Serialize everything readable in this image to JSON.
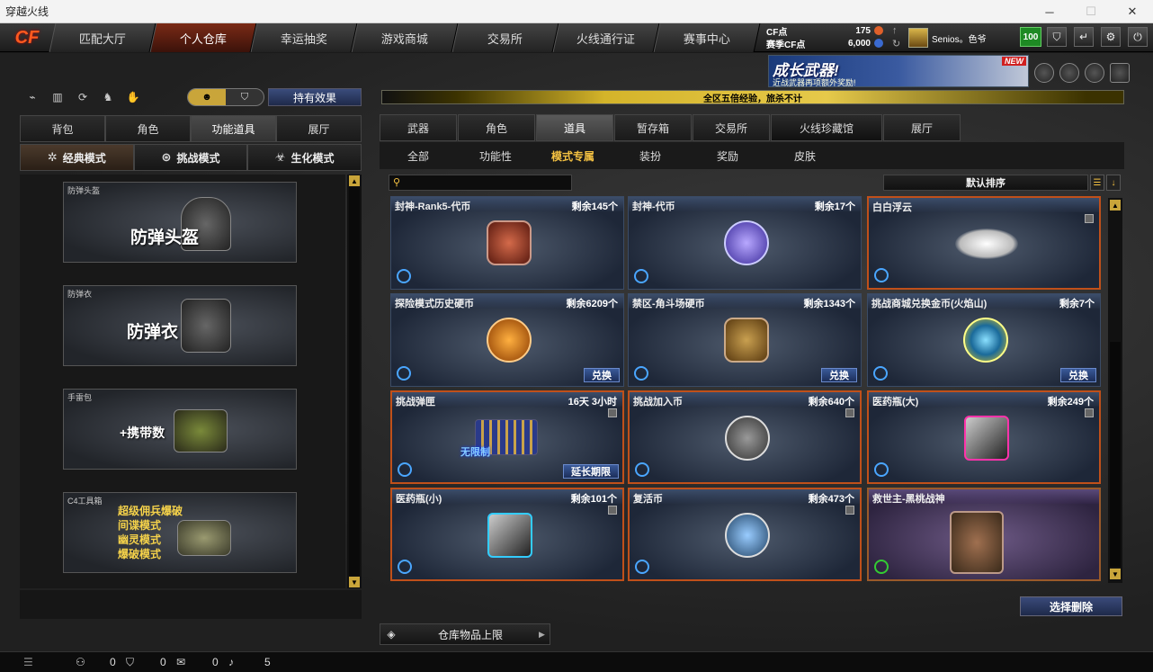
{
  "window": {
    "title": "穿越火线"
  },
  "nav": {
    "logo": "CF",
    "tabs": [
      "匹配大厅",
      "个人仓库",
      "幸运抽奖",
      "游戏商城",
      "交易所",
      "火线通行证",
      "赛事中心"
    ],
    "active_tab": "个人仓库"
  },
  "points": {
    "cf_label": "CF点",
    "cf_value": "175",
    "bonus_label": "赛季CF点",
    "bonus_value": "6,000"
  },
  "user": {
    "name": "Senios。色爷",
    "level": "100"
  },
  "left": {
    "toggle_icons": [
      "skull-icon",
      "shield-icon"
    ],
    "effect_button": "持有效果",
    "tabs": [
      "背包",
      "角色",
      "功能道具",
      "展厅"
    ],
    "active_tab": "功能道具",
    "modes": [
      "经典模式",
      "挑战模式",
      "生化模式"
    ],
    "active_mode": "经典模式",
    "cards": [
      {
        "label": "防弹头盔",
        "title": "防弹头盔"
      },
      {
        "label": "防弹衣",
        "title": "防弹衣"
      },
      {
        "label": "手雷包",
        "title": "+携带数"
      },
      {
        "label": "C4工具箱",
        "lines": [
          "超级佣兵爆破",
          "间谍模式",
          "幽灵模式",
          "爆破模式"
        ]
      }
    ]
  },
  "banner": {
    "title": "成长武器!",
    "subtitle": "近战武器再项额外奖励!",
    "badge": "NEW"
  },
  "marquee": "全区五倍经验，旅杀不计",
  "right": {
    "tabs": [
      "武器",
      "角色",
      "道具",
      "暂存箱",
      "交易所",
      "火线珍藏馆",
      "展厅"
    ],
    "active_tab": "道具",
    "subtabs": [
      "全部",
      "功能性",
      "模式专属",
      "装扮",
      "奖励",
      "皮肤"
    ],
    "active_subtab": "模式专属",
    "sort": "默认排序",
    "items": [
      {
        "name": "封神-Rank5-代币",
        "count": "剩余145个"
      },
      {
        "name": "封神-代币",
        "count": "剩余17个"
      },
      {
        "name": "白白浮云",
        "count": ""
      },
      {
        "name": "探险模式历史硬币",
        "count": "剩余6209个",
        "action": "兑换"
      },
      {
        "name": "禁区-角斗场硬币",
        "count": "剩余1343个",
        "action": "兑换"
      },
      {
        "name": "挑战商城兑换金币(火焰山)",
        "count": "剩余7个",
        "action": "兑换"
      },
      {
        "name": "挑战弹匣",
        "count": "16天 3小时",
        "action": "延长期限",
        "overlay": "无限制"
      },
      {
        "name": "挑战加入币",
        "count": "剩余640个"
      },
      {
        "name": "医药瓶(大)",
        "count": "剩余249个"
      },
      {
        "name": "医药瓶(小)",
        "count": "剩余101个"
      },
      {
        "name": "复活币",
        "count": "剩余473个"
      },
      {
        "name": "救世主-黑桃战神",
        "count": ""
      }
    ],
    "delete_button": "选择删除",
    "capacity_label": "仓库物品上限"
  },
  "status": {
    "a": "0",
    "b": "0",
    "c": "0",
    "d": "5"
  }
}
